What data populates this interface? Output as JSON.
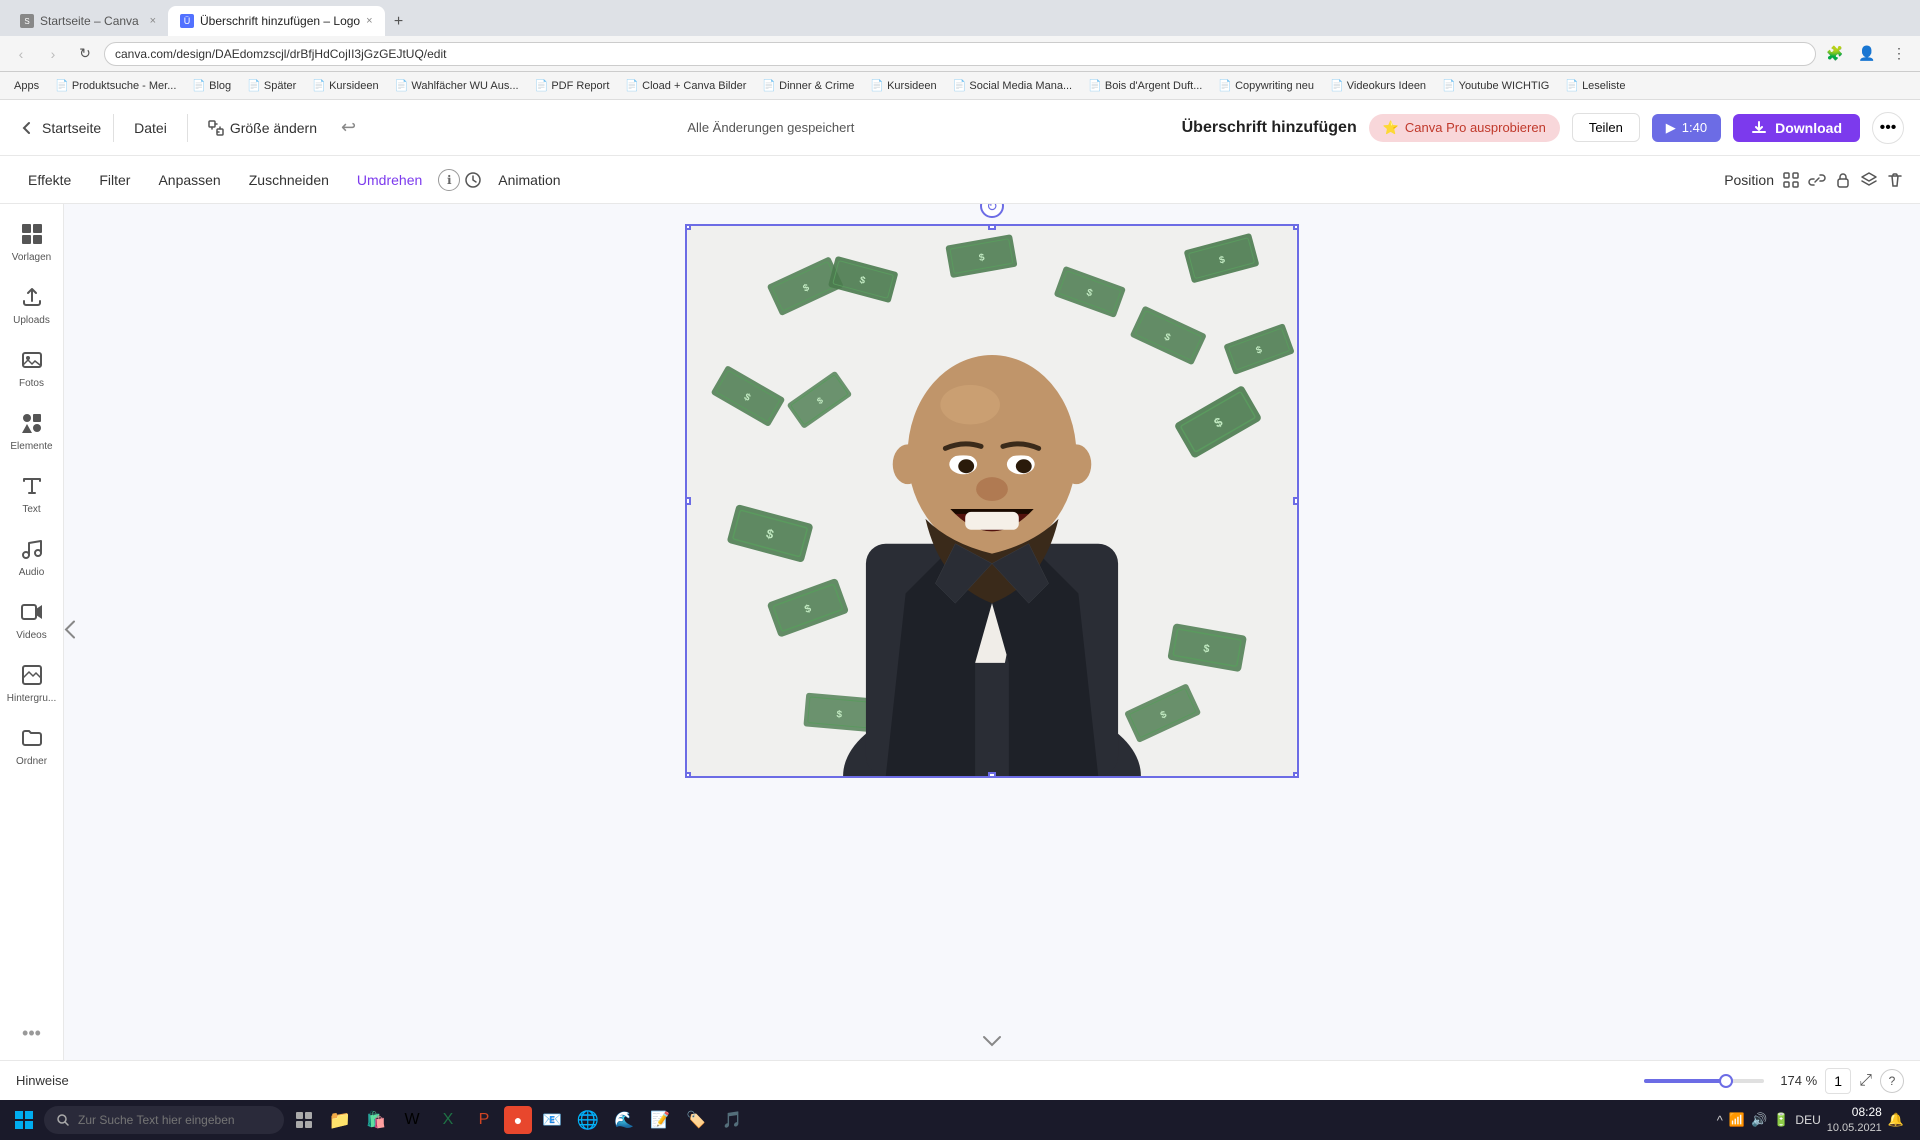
{
  "browser": {
    "tabs": [
      {
        "id": "tab1",
        "label": "Startseite – Canva",
        "active": false,
        "favicon": "S"
      },
      {
        "id": "tab2",
        "label": "Überschrift hinzufügen – Logo",
        "active": true,
        "favicon": "Ü"
      }
    ],
    "new_tab_label": "+",
    "address": "canva.com/design/DAEdomzscjl/drBfjHdCojII3jGzGEJtUQ/edit",
    "bookmarks": [
      "Apps",
      "Produktsuche - Mer...",
      "Blog",
      "Später",
      "Kursideen",
      "Wahlfächer WU Aus...",
      "PDF Report",
      "Cload + Canva Bilder",
      "Dinner & Crime",
      "Kursideen",
      "Social Media Mana...",
      "Bois d'Argent Duft...",
      "Copywriting neu",
      "Videokurs Ideen",
      "Youtube WICHTIG",
      "Leseliste"
    ]
  },
  "topbar": {
    "home_label": "Startseite",
    "file_label": "Datei",
    "resize_label": "Größe ändern",
    "save_status": "Alle Änderungen gespeichert",
    "design_title": "Überschrift hinzufügen",
    "pro_label": "Canva Pro ausprobieren",
    "share_label": "Teilen",
    "play_label": "1:40",
    "download_label": "Download",
    "more_icon": "•••"
  },
  "toolbar": {
    "items": [
      {
        "id": "effekte",
        "label": "Effekte"
      },
      {
        "id": "filter",
        "label": "Filter"
      },
      {
        "id": "anpassen",
        "label": "Anpassen"
      },
      {
        "id": "zuschneiden",
        "label": "Zuschneiden"
      },
      {
        "id": "umdrehen",
        "label": "Umdrehen",
        "active": true
      },
      {
        "id": "info",
        "label": "ℹ"
      },
      {
        "id": "animation",
        "label": "Animation"
      }
    ],
    "right": {
      "position_label": "Position"
    }
  },
  "sidebar": {
    "items": [
      {
        "id": "vorlagen",
        "label": "Vorlagen",
        "icon": "grid"
      },
      {
        "id": "uploads",
        "label": "Uploads",
        "icon": "upload"
      },
      {
        "id": "fotos",
        "label": "Fotos",
        "icon": "image"
      },
      {
        "id": "elemente",
        "label": "Elemente",
        "icon": "shapes"
      },
      {
        "id": "text",
        "label": "Text",
        "icon": "T"
      },
      {
        "id": "audio",
        "label": "Audio",
        "icon": "music"
      },
      {
        "id": "videos",
        "label": "Videos",
        "icon": "video"
      },
      {
        "id": "hintergrund",
        "label": "Hintergru...",
        "icon": "photo"
      },
      {
        "id": "ordner",
        "label": "Ordner",
        "icon": "folder"
      }
    ],
    "dots_icon": "•••"
  },
  "canvas": {
    "rotate_icon": "↻",
    "scene_description": "Man in suit laughing with money bills raining around him"
  },
  "bottombar": {
    "hints_label": "Hinweise",
    "zoom_percent": "174 %",
    "zoom_value": 74,
    "page_indicator": "1"
  },
  "taskbar": {
    "search_placeholder": "Zur Suche Text hier eingeben",
    "time": "08:28",
    "date": "10.05.2021",
    "locale": "DEU",
    "apps": [
      "⊞",
      "🔍",
      "📁",
      "📋",
      "W",
      "X",
      "P",
      "🔴",
      "🌐",
      "🦊",
      "📧",
      "🎵"
    ]
  }
}
